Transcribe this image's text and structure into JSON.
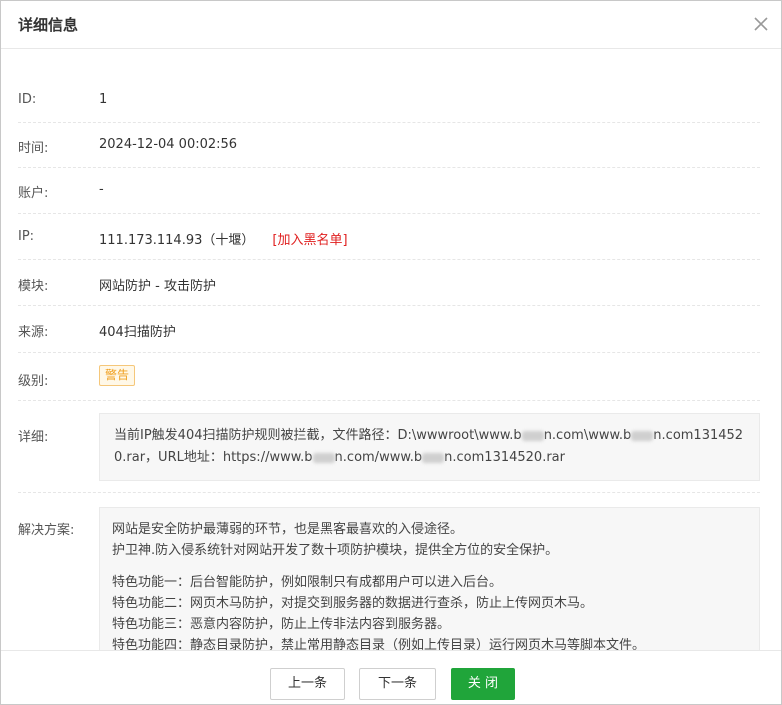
{
  "dialog": {
    "title": "详细信息"
  },
  "fields": {
    "id": {
      "label": "ID:",
      "value": "1"
    },
    "time": {
      "label": "时间:",
      "value": "2024-12-04 00:02:56"
    },
    "account": {
      "label": "账户:",
      "value": "-"
    },
    "ip": {
      "label": "IP:",
      "value": "111.173.114.93（十堰）",
      "action": "[加入黑名单]"
    },
    "module": {
      "label": "模块:",
      "value": "网站防护 - 攻击防护"
    },
    "source": {
      "label": "来源:",
      "value": "404扫描防护"
    },
    "level": {
      "label": "级别:",
      "value": "警告"
    },
    "detail": {
      "label": "详细:",
      "parts": [
        "当前IP触发404扫描防护规则被拦截，文件路径：D:\\wwwroot\\www.b",
        "n.com\\www.b",
        "n.com131452",
        "0.rar，URL地址：https://www.b",
        "n.com/www.b",
        "n.com1314520.rar"
      ]
    },
    "solution": {
      "label": "解决方案:",
      "lines": [
        "网站是安全防护最薄弱的环节，也是黑客最喜欢的入侵途径。",
        "护卫神.防入侵系统针对网站开发了数十项防护模块，提供全方位的安全保护。",
        "特色功能一：后台智能防护，例如限制只有成都用户可以进入后台。",
        "特色功能二：网页木马防护，对提交到服务器的数据进行查杀，防止上传网页木马。",
        "特色功能三：恶意内容防护，防止上传非法内容到服务器。",
        "特色功能四：静态目录防护，禁止常用静态目录（例如上传目录）运行网页木马等脚本文件。"
      ]
    }
  },
  "footer": {
    "prev_label": "上一条",
    "next_label": "下一条",
    "close_label": "关 闭"
  },
  "colors": {
    "primary": "#20a53a",
    "danger": "#e02020",
    "warning": "#f0a020"
  }
}
